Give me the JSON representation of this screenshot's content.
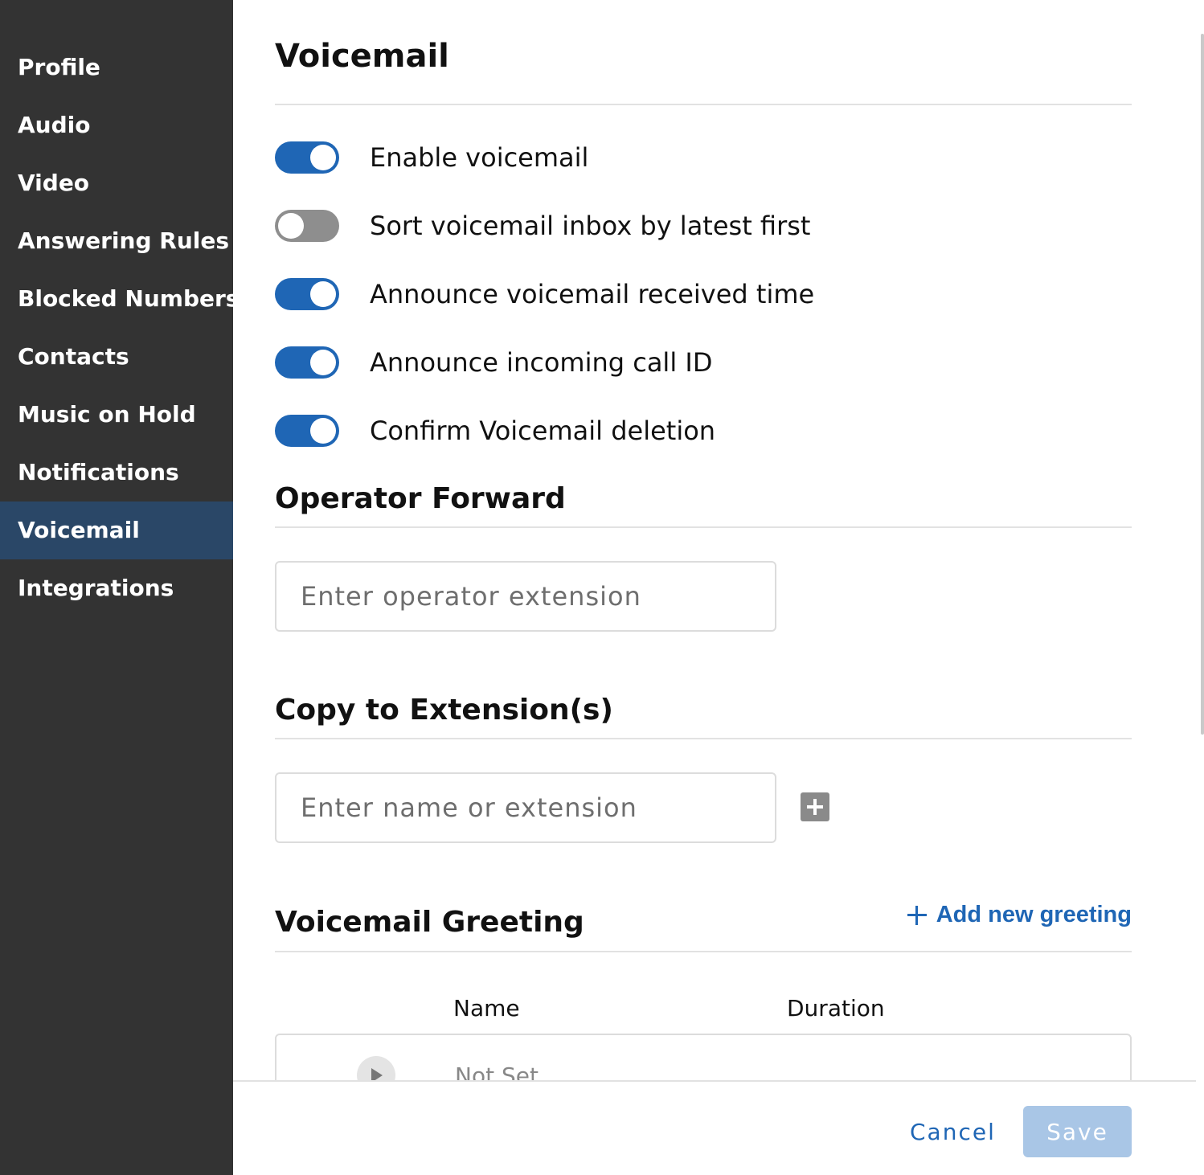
{
  "sidebar": {
    "items": [
      {
        "label": "Profile",
        "active": false
      },
      {
        "label": "Audio",
        "active": false
      },
      {
        "label": "Video",
        "active": false
      },
      {
        "label": "Answering Rules",
        "active": false
      },
      {
        "label": "Blocked Numbers",
        "active": false
      },
      {
        "label": "Contacts",
        "active": false
      },
      {
        "label": "Music on Hold",
        "active": false
      },
      {
        "label": "Notifications",
        "active": false
      },
      {
        "label": "Voicemail",
        "active": true
      },
      {
        "label": "Integrations",
        "active": false
      }
    ]
  },
  "main": {
    "title": "Voicemail",
    "toggles": [
      {
        "label": "Enable voicemail",
        "on": true
      },
      {
        "label": "Sort voicemail inbox by latest first",
        "on": false
      },
      {
        "label": "Announce voicemail received time",
        "on": true
      },
      {
        "label": "Announce incoming call ID",
        "on": true
      },
      {
        "label": "Confirm Voicemail deletion",
        "on": true
      }
    ],
    "operator_forward": {
      "title": "Operator Forward",
      "placeholder": "Enter operator extension"
    },
    "copy_to_extensions": {
      "title": "Copy to Extension(s)",
      "placeholder": "Enter name or extension"
    },
    "greeting": {
      "title": "Voicemail Greeting",
      "add_label": "Add new greeting",
      "columns": {
        "name": "Name",
        "duration": "Duration"
      },
      "rows": [
        {
          "name": "Not Set"
        }
      ]
    }
  },
  "footer": {
    "cancel_label": "Cancel",
    "save_label": "Save"
  },
  "colors": {
    "sidebar_bg": "#333333",
    "sidebar_active": "#2a4767",
    "accent": "#1f66b5",
    "toggle_off": "#8e8e8e",
    "save_disabled": "#a9c6e6"
  }
}
